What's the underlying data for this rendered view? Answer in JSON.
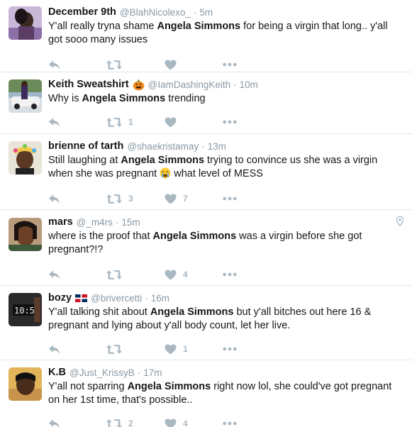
{
  "tweets": [
    {
      "name": "December 9th",
      "handle": "@BlahNicolexo_",
      "time": "5m",
      "text_before": "Y'all really tryna shame ",
      "text_bold": "Angela Simmons",
      "text_after": " for being a virgin that long.. y'all got sooo many issues",
      "retweets": "",
      "likes": ""
    },
    {
      "name": "Keith Sweatshirt",
      "name_emoji": "jack-o-lantern",
      "handle": "@IamDashingKeith",
      "time": "10m",
      "text_before": "Why is ",
      "text_bold": "Angela Simmons",
      "text_after": " trending",
      "retweets": "1",
      "likes": ""
    },
    {
      "name": "brienne of tarth",
      "handle": "@shaekristamay",
      "time": "13m",
      "text_before": "Still laughing at ",
      "text_bold": "Angela Simmons",
      "text_after": " trying to convince us she was a virgin when she was pregnant",
      "text_emoji": "crying-face",
      "text_after2": " what level of MESS",
      "retweets": "3",
      "likes": "7"
    },
    {
      "name": "mars",
      "handle": "@_m4rs",
      "time": "15m",
      "text_before": "where is the proof that ",
      "text_bold": "Angela Simmons",
      "text_after": " was a virgin before she got pregnant?!?",
      "retweets": "",
      "likes": "4",
      "geo": "location-pin-icon"
    },
    {
      "name": "bozy",
      "name_emoji": "dominican-republic-flag",
      "handle": "@brivercetti",
      "time": "16m",
      "text_before": "Y'all talking shit about ",
      "text_bold": "Angela Simmons",
      "text_after": " but y'all bitches out here 16 & pregnant and lying about y'all body count, let her live.",
      "retweets": "",
      "likes": "1"
    },
    {
      "name": "K.B",
      "handle": "@Just_KrissyB",
      "time": "17m",
      "text_before": "Y'all not sparring ",
      "text_bold": "Angela Simmons",
      "text_after": " right now lol, she could've got pregnant on her 1st time, that's possible..",
      "retweets": "2",
      "likes": "4"
    }
  ],
  "separator": "·",
  "colors": {
    "text": "#14171a",
    "muted": "#8899a6",
    "icon": "#aab8c2",
    "border": "#e1e8ed"
  }
}
